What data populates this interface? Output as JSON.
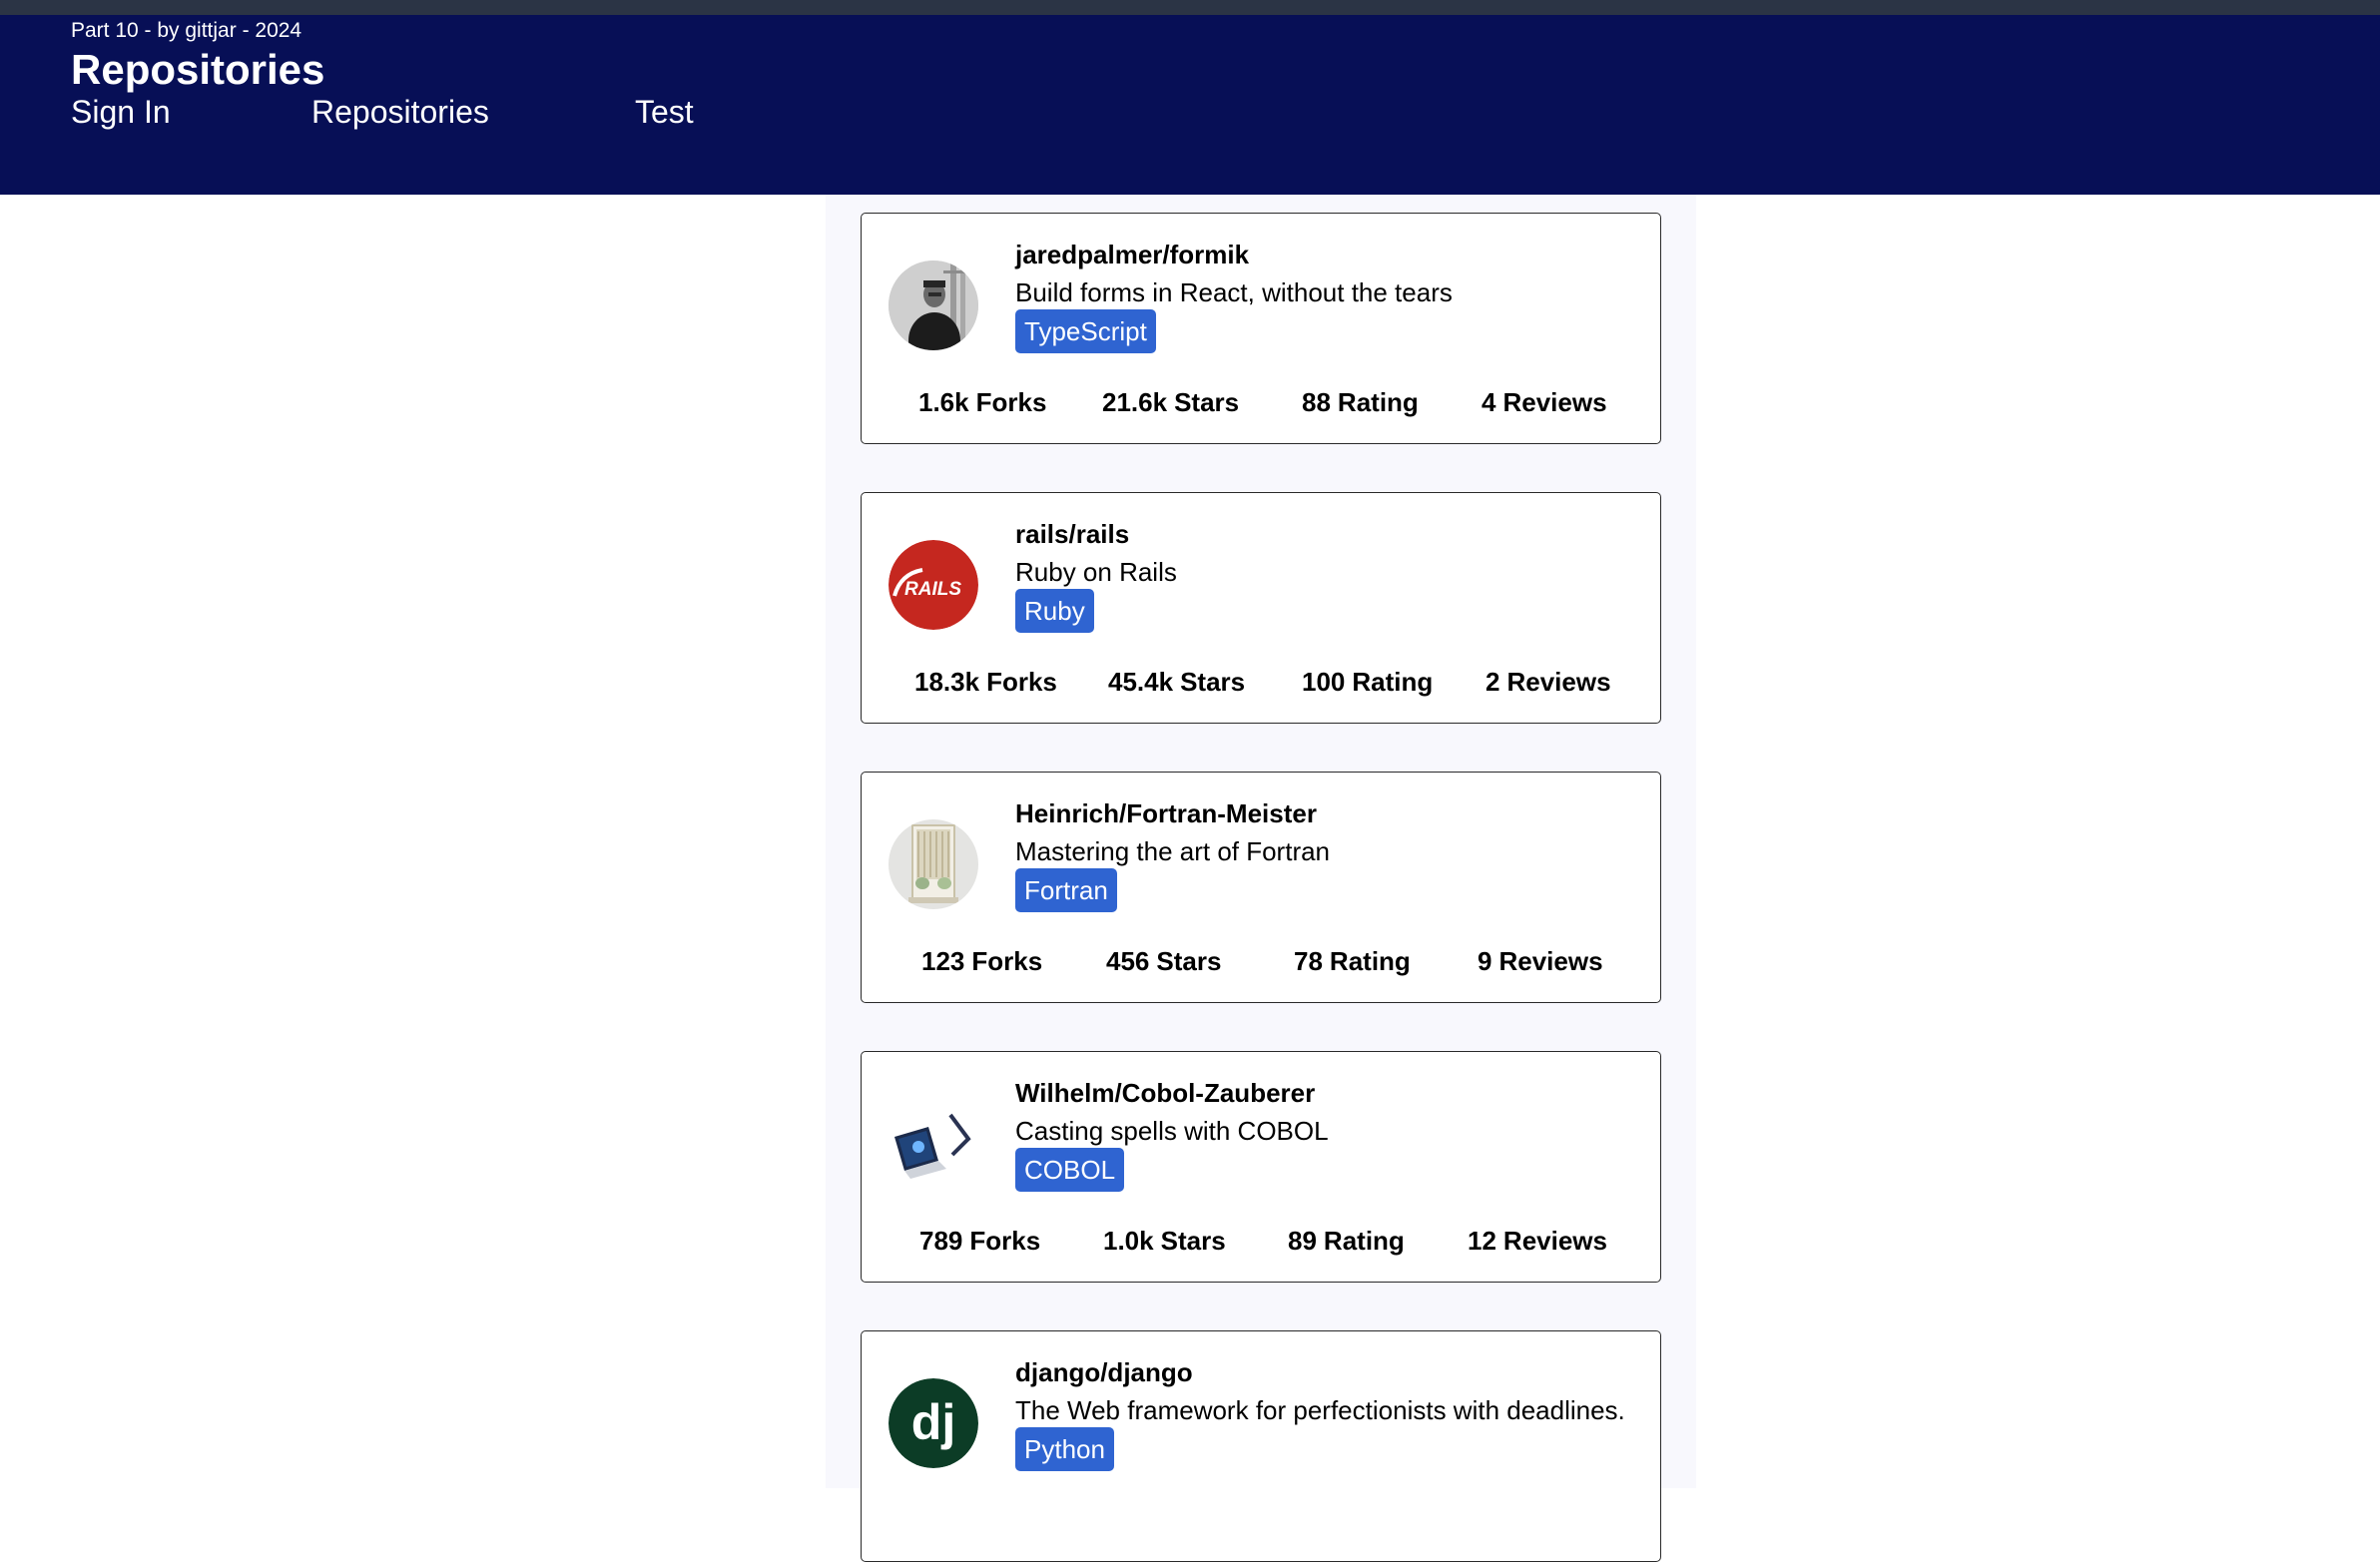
{
  "header": {
    "subtitle": "Part 10 - by gittjar - 2024",
    "title": "Repositories",
    "nav": [
      {
        "label": "Sign In"
      },
      {
        "label": "Repositories"
      },
      {
        "label": "Test"
      }
    ]
  },
  "colors": {
    "appbar": "#070f56",
    "topstrip": "#2b3445",
    "language_badge": "#2f64d1",
    "list_background": "#f8f8fd"
  },
  "stat_labels": {
    "forks": "Forks",
    "stars": "Stars",
    "rating": "Rating",
    "reviews": "Reviews"
  },
  "repositories": [
    {
      "full_name": "jaredpalmer/formik",
      "description": "Build forms in React, without the tears",
      "language": "TypeScript",
      "forks": "1.6k",
      "stars": "21.6k",
      "rating": "88",
      "reviews": "4",
      "avatar": "person-photo"
    },
    {
      "full_name": "rails/rails",
      "description": "Ruby on Rails",
      "language": "Ruby",
      "forks": "18.3k",
      "stars": "45.4k",
      "rating": "100",
      "reviews": "2",
      "avatar": "rails-logo",
      "avatar_text": "RAILS"
    },
    {
      "full_name": "Heinrich/Fortran-Meister",
      "description": "Mastering the art of Fortran",
      "language": "Fortran",
      "forks": "123",
      "stars": "456",
      "rating": "78",
      "reviews": "9",
      "avatar": "window-photo"
    },
    {
      "full_name": "Wilhelm/Cobol-Zauberer",
      "description": "Casting spells with COBOL",
      "language": "COBOL",
      "forks": "789",
      "stars": "1.0k",
      "rating": "89",
      "reviews": "12",
      "avatar": "laptop-photo"
    },
    {
      "full_name": "django/django",
      "description": "The Web framework for perfectionists with deadlines.",
      "language": "Python",
      "avatar": "django-logo",
      "avatar_text": "dj"
    }
  ]
}
